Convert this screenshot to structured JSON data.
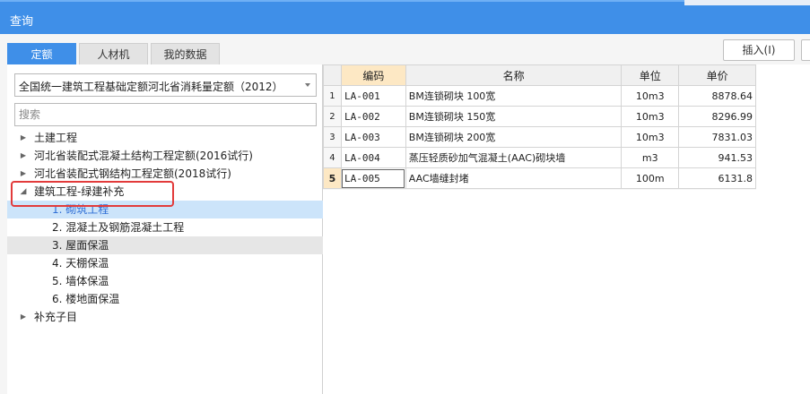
{
  "window": {
    "title": "查询"
  },
  "tabs": [
    {
      "label": "定额",
      "active": true
    },
    {
      "label": "人材机",
      "active": false
    },
    {
      "label": "我的数据",
      "active": false
    }
  ],
  "toolbar": {
    "insert_label": "插入(I)"
  },
  "library": {
    "selected": "全国统一建筑工程基础定额河北省消耗量定额（2012）",
    "search_placeholder": "搜索"
  },
  "tree": [
    {
      "label": "土建工程",
      "state": "collapsed"
    },
    {
      "label": "河北省装配式混凝土结构工程定额(2016试行)",
      "state": "collapsed"
    },
    {
      "label": "河北省装配式钢结构工程定额(2018试行)",
      "state": "collapsed"
    },
    {
      "label": "建筑工程-绿建补充",
      "state": "expanded"
    },
    {
      "label": "1. 砌筑工程",
      "state": "leaf",
      "selected": true
    },
    {
      "label": "2. 混凝土及钢筋混凝土工程",
      "state": "leaf"
    },
    {
      "label": "3. 屋面保温",
      "state": "leaf",
      "hover": true
    },
    {
      "label": "4. 天棚保温",
      "state": "leaf"
    },
    {
      "label": "5. 墙体保温",
      "state": "leaf"
    },
    {
      "label": "6. 楼地面保温",
      "state": "leaf"
    },
    {
      "label": "补充子目",
      "state": "collapsed"
    }
  ],
  "table": {
    "headers": [
      "编码",
      "名称",
      "单位",
      "单价"
    ],
    "rows": [
      {
        "idx": "1",
        "code": "LA-001",
        "name": "BM连锁砌块 100宽",
        "unit": "10m3",
        "price": "8878.64"
      },
      {
        "idx": "2",
        "code": "LA-002",
        "name": "BM连锁砌块 150宽",
        "unit": "10m3",
        "price": "8296.99"
      },
      {
        "idx": "3",
        "code": "LA-003",
        "name": "BM连锁砌块 200宽",
        "unit": "10m3",
        "price": "7831.03"
      },
      {
        "idx": "4",
        "code": "LA-004",
        "name": "蒸压轻质砂加气混凝土(AAC)砌块墙",
        "unit": "m3",
        "price": "941.53"
      },
      {
        "idx": "5",
        "code": "LA-005",
        "name": "AAC墙缝封堵",
        "unit": "100m",
        "price": "6131.8"
      }
    ]
  },
  "colors": {
    "accent": "#3f8fe8",
    "highlight": "#e23b3b",
    "selected_row": "#cce4fa"
  }
}
